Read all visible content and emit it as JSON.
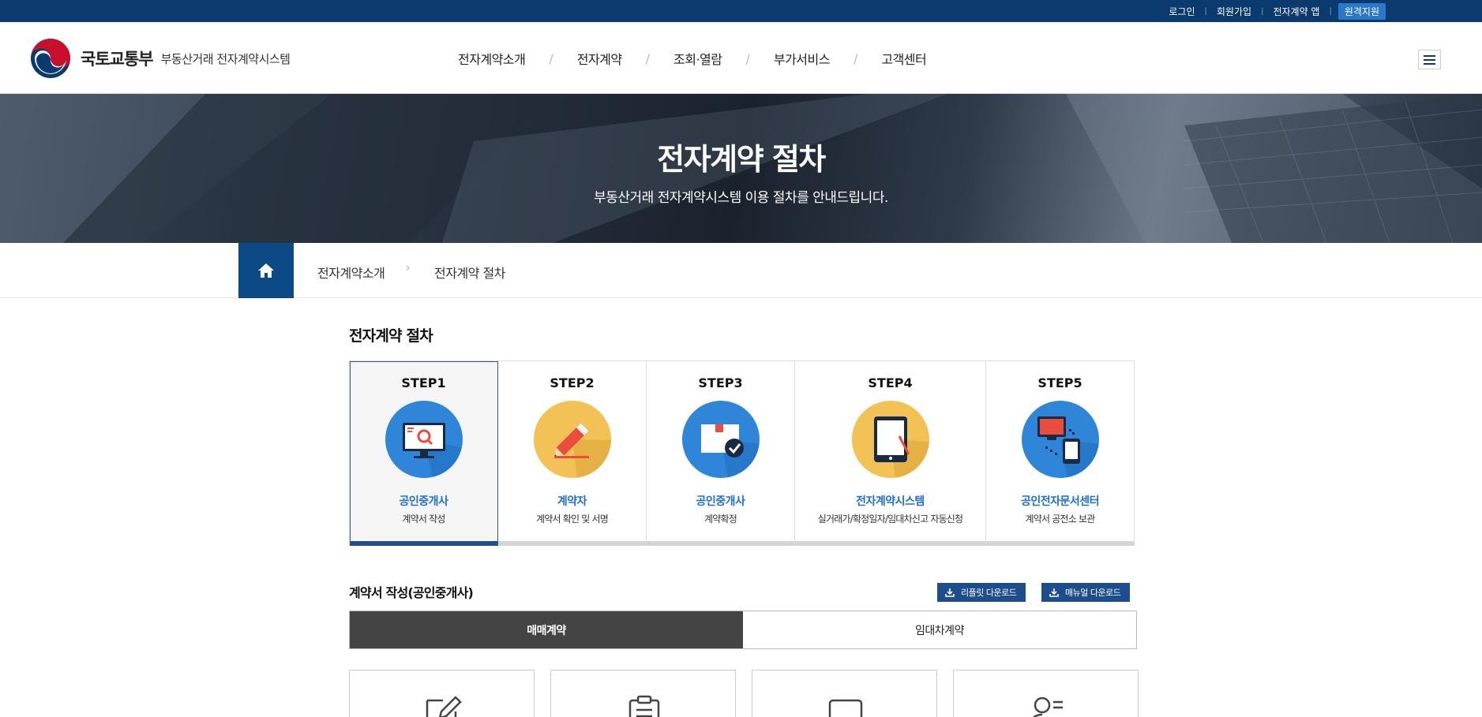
{
  "topbar": {
    "links": [
      {
        "label": "로그인"
      },
      {
        "label": "회원가입"
      },
      {
        "label": "전자계약 앱"
      },
      {
        "label": "원격지원"
      }
    ]
  },
  "header": {
    "ministry": "국토교통부",
    "system": "부동산거래 전자계약시스템",
    "nav": [
      "전자계약소개",
      "전자계약",
      "조회·열람",
      "부가서비스",
      "고객센터"
    ],
    "menu_icon": "hamburger-icon"
  },
  "hero": {
    "title": "전자계약 절차",
    "subtitle": "부동산거래 전자계약시스템 이용 절차를 안내드립니다."
  },
  "breadcrumb": {
    "home_icon": "home-icon",
    "items": [
      "전자계약소개",
      "전자계약 절차"
    ]
  },
  "section": {
    "title": "전자계약 절차"
  },
  "steps": [
    {
      "label": "STEP1",
      "actor": "공인중개사",
      "desc": "계약서 작성",
      "icon": "monitor-search-icon",
      "active": true
    },
    {
      "label": "STEP2",
      "actor": "계약자",
      "desc": "계약서 확인 및 서명",
      "icon": "pencil-icon",
      "active": false
    },
    {
      "label": "STEP3",
      "actor": "공인중개사",
      "desc": "계약확정",
      "icon": "box-check-icon",
      "active": false
    },
    {
      "label": "STEP4",
      "actor": "전자계약시스템",
      "desc": "실거래가/확정일자/임대차신고 자동신청",
      "icon": "tablet-icon",
      "active": false
    },
    {
      "label": "STEP5",
      "actor": "공인전자문서센터",
      "desc": "계약서 공전소 보관",
      "icon": "devices-icon",
      "active": false
    }
  ],
  "subsection": {
    "title": "계약서 작성(공인중개사)",
    "leaflet_btn": "리플릿 다운로드",
    "manual_btn": "매뉴얼 다운로드"
  },
  "tabs": [
    {
      "label": "매매계약",
      "active": true
    },
    {
      "label": "임대차계약",
      "active": false
    }
  ],
  "cards": [
    {
      "icon": "edit-icon"
    },
    {
      "icon": "clipboard-icon"
    },
    {
      "icon": "laptop-icon"
    },
    {
      "icon": "user-list-icon"
    }
  ],
  "colors": {
    "topbar": "#0b3a6e",
    "accent_blue": "#1e6fd0",
    "active_step_bar": "#1f4f8e",
    "active_tab": "#444444"
  }
}
